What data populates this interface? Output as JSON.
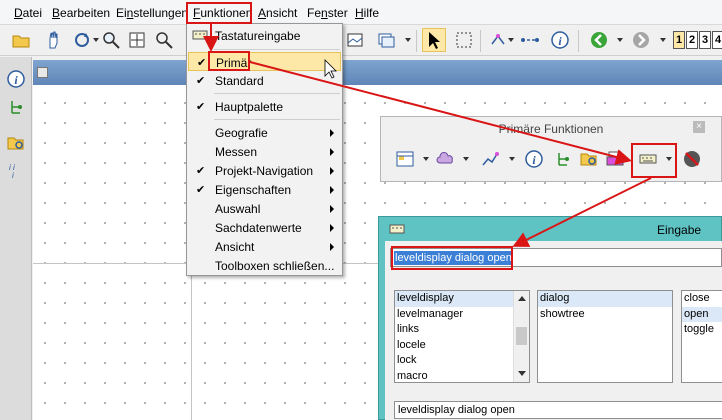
{
  "menubar": {
    "items": [
      {
        "pre": "",
        "u": "D",
        "post": "atei"
      },
      {
        "pre": "",
        "u": "B",
        "post": "earbeiten"
      },
      {
        "pre": "Ei",
        "u": "n",
        "post": "stellungen"
      },
      {
        "pre": "",
        "u": "F",
        "post": "unktionen"
      },
      {
        "pre": "",
        "u": "A",
        "post": "nsicht"
      },
      {
        "pre": "Fe",
        "u": "n",
        "post": "ster"
      },
      {
        "pre": "",
        "u": "H",
        "post": "ilfe"
      }
    ]
  },
  "toolbar": {
    "icons": [
      "open-folder-icon",
      "pan-hand-icon",
      "rotate-icon",
      "zoom-icon",
      "zoom-extent-icon",
      "zoom-window-icon",
      "view-icon",
      "layer-icon",
      "select-arrow-icon",
      "rect-select-icon",
      "node-icon",
      "measure-icon",
      "info-icon",
      "back-icon",
      "forward-icon"
    ],
    "number_buttons": [
      "1",
      "2",
      "3",
      "4"
    ]
  },
  "funktionen_menu": {
    "items": [
      {
        "label": "Tastatureingabe",
        "checked": false,
        "submenu": false
      },
      {
        "label": "Primär",
        "checked": true,
        "submenu": false
      },
      {
        "label": "Standard",
        "checked": true,
        "submenu": false
      },
      {
        "label": "Hauptpalette",
        "checked": true,
        "submenu": false
      },
      {
        "label": "Geografie",
        "checked": false,
        "submenu": true
      },
      {
        "label": "Messen",
        "checked": false,
        "submenu": true
      },
      {
        "label": "Projekt-Navigation",
        "checked": true,
        "submenu": true
      },
      {
        "label": "Eigenschaften",
        "checked": true,
        "submenu": true
      },
      {
        "label": "Auswahl",
        "checked": false,
        "submenu": true
      },
      {
        "label": "Sachdatenwerte",
        "checked": false,
        "submenu": true
      },
      {
        "label": "Ansicht",
        "checked": false,
        "submenu": true
      },
      {
        "label": "Toolboxen schließen...",
        "checked": false,
        "submenu": false
      }
    ]
  },
  "palette": {
    "title": "Primäre Funktionen",
    "close": "×"
  },
  "dialog": {
    "title": "Eingabe",
    "input_value": "leveldisplay dialog open",
    "list1": [
      "leveldisplay",
      "levelmanager",
      "links",
      "locele",
      "lock",
      "macro"
    ],
    "list2": [
      "dialog",
      "showtree"
    ],
    "list3": [
      "close",
      "open",
      "toggle"
    ],
    "history": "leveldisplay dialog open"
  },
  "colors": {
    "annotation_red": "#d91515",
    "dialog_title_bar": "#5fc3c4",
    "menu_highlight": "#fde8a8",
    "view_header": "#6d94c4"
  }
}
